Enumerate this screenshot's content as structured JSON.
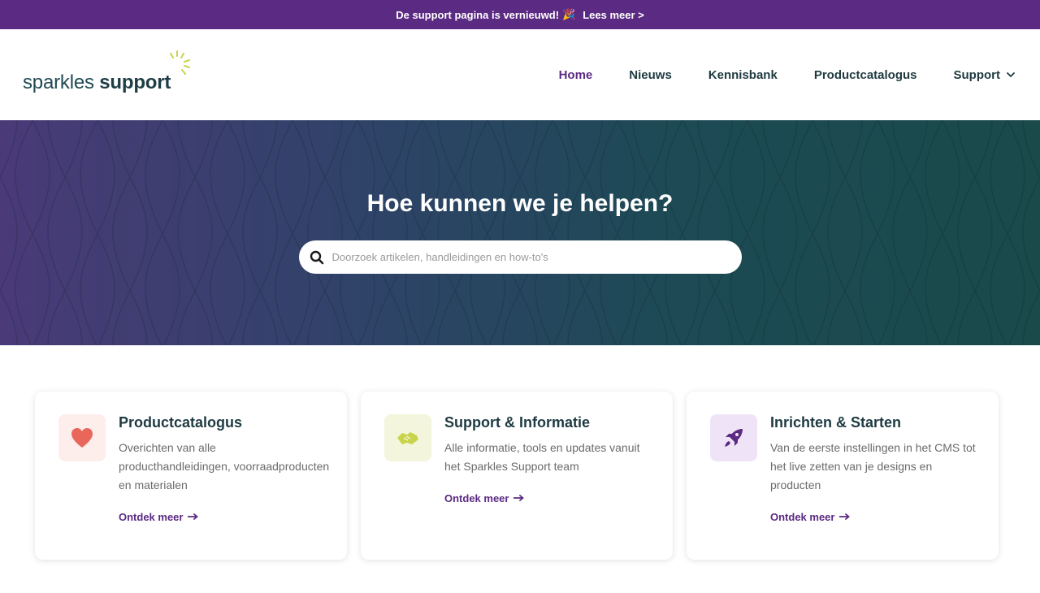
{
  "announcement": {
    "text": "De support pagina is vernieuwd!",
    "emoji": "🎉",
    "link": "Lees meer >"
  },
  "logo": {
    "part1": "sparkles",
    "part2": "support"
  },
  "nav": {
    "items": [
      {
        "label": "Home",
        "active": true
      },
      {
        "label": "Nieuws"
      },
      {
        "label": "Kennisbank"
      },
      {
        "label": "Productcatalogus"
      },
      {
        "label": "Support",
        "dropdown": true
      }
    ]
  },
  "hero": {
    "title": "Hoe kunnen we je helpen?",
    "search_placeholder": "Doorzoek artikelen, handleidingen en how-to's"
  },
  "cards": [
    {
      "title": "Productcatalogus",
      "description": "Overichten van alle producthandleidingen, voorraadproducten en materialen",
      "link": "Ontdek meer",
      "icon": "heart-icon",
      "icon_color": "#e8675a",
      "icon_bg": "#fdeeec"
    },
    {
      "title": "Support & Informatie",
      "description": "Alle informatie, tools en updates vanuit het Sparkles Support team",
      "link": "Ontdek meer",
      "icon": "handshake-icon",
      "icon_color": "#c9d44a",
      "icon_bg": "#f3f6dc"
    },
    {
      "title": "Inrichten & Starten",
      "description": "Van de eerste instellingen in het CMS tot het live zetten van je designs en producten",
      "link": "Ontdek meer",
      "icon": "rocket-icon",
      "icon_color": "#5b2a82",
      "icon_bg": "#efe4f7"
    }
  ],
  "colors": {
    "brand_purple": "#5b2a82",
    "brand_teal": "#1e3d45"
  }
}
